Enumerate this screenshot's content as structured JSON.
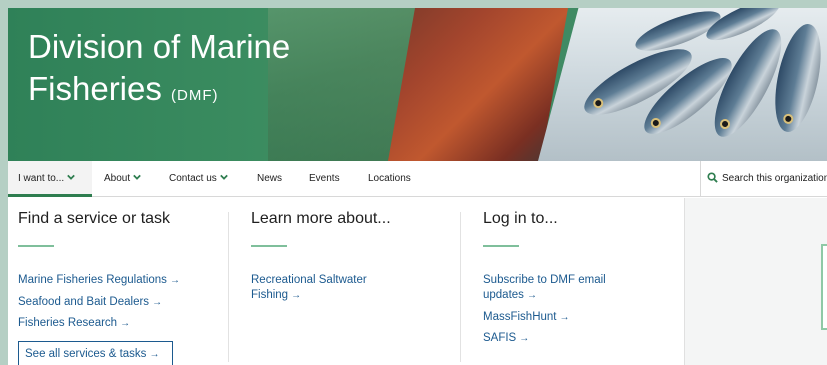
{
  "hero": {
    "title_line1": "Division of Marine",
    "title_line2": "Fisheries",
    "title_abbr": "(DMF)"
  },
  "nav": {
    "items": [
      {
        "label": "I want to...",
        "has_chevron": true,
        "active": true
      },
      {
        "label": "About",
        "has_chevron": true
      },
      {
        "label": "Contact us",
        "has_chevron": true
      },
      {
        "label": "News"
      },
      {
        "label": "Events"
      },
      {
        "label": "Locations"
      }
    ],
    "search_label": "Search this organization"
  },
  "panel": {
    "col1": {
      "heading": "Find a service or task",
      "links": [
        "Marine Fisheries Regulations",
        "Seafood and Bait Dealers",
        "Fisheries Research"
      ],
      "button": "See all services & tasks"
    },
    "col2": {
      "heading": "Learn more about...",
      "link_line1": "Recreational Saltwater",
      "link_line2": "Fishing"
    },
    "col3": {
      "heading": "Log in to...",
      "link1_line1": "Subscribe to DMF email",
      "link1_line2": "updates",
      "link2": "MassFishHunt",
      "link3": "SAFIS"
    }
  },
  "side": {
    "partial_glyphs": [
      "→",
      "→",
      "u"
    ]
  },
  "colors": {
    "brand_green": "#2e7d4f",
    "link_blue": "#1c5a8f",
    "accent_rule": "#7fbf9b"
  },
  "icons": {
    "chevron": "chevron-down-icon",
    "search": "search-icon",
    "arrow": "arrow-right-icon"
  }
}
